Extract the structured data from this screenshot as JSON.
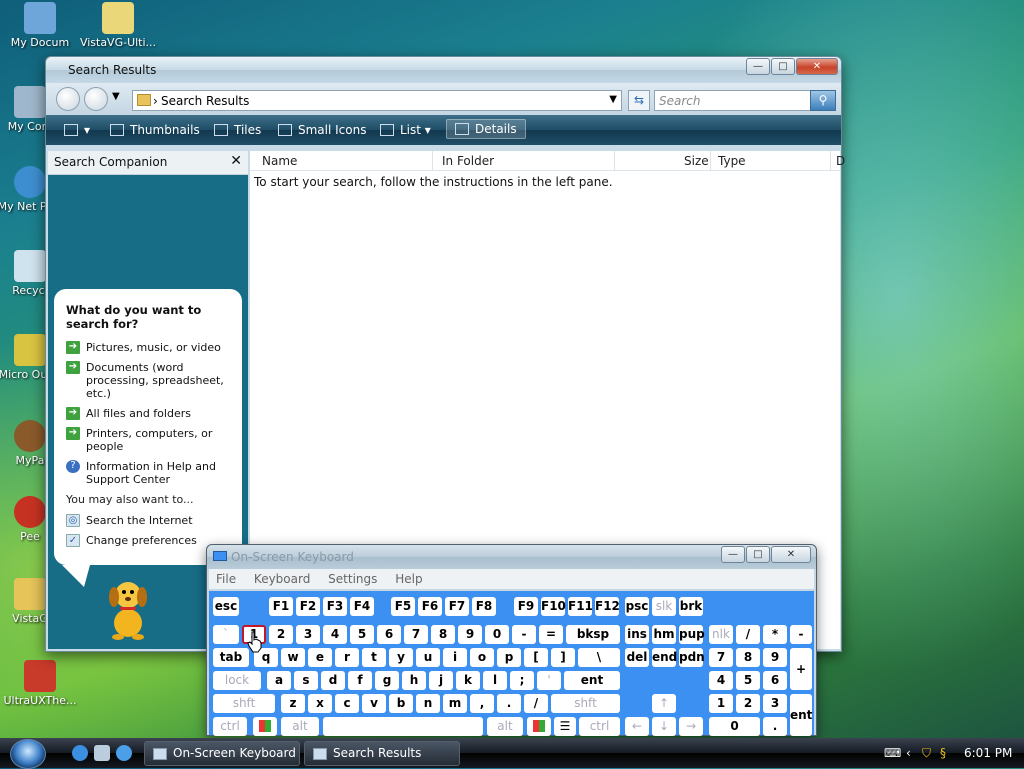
{
  "desktop": {
    "icons": [
      {
        "label": "My Docum"
      },
      {
        "label": "VistaVG-Ulti..."
      },
      {
        "label": "My Com"
      },
      {
        "label": "My Net Plac"
      },
      {
        "label": "Recycl"
      },
      {
        "label": "Micro Outlo"
      },
      {
        "label": "MyPa"
      },
      {
        "label": "Pee"
      },
      {
        "label": "VistaG"
      },
      {
        "label": "UltraUXThe..."
      }
    ]
  },
  "explorer": {
    "title": "Search Results",
    "address": "Search Results",
    "search_placeholder": "Search",
    "toolbar": [
      "Thumbnails",
      "Tiles",
      "Small Icons",
      "List",
      "Details"
    ],
    "companion_title": "Search Companion",
    "question": "What do you want to search for?",
    "options": [
      "Pictures, music, or video",
      "Documents (word processing, spreadsheet, etc.)",
      "All files and folders",
      "Printers, computers, or people",
      "Information in Help and Support Center"
    ],
    "also_label": "You may also want to...",
    "also_options": [
      "Search the Internet",
      "Change preferences"
    ],
    "columns": [
      "Name",
      "In Folder",
      "Size",
      "Type",
      "D"
    ],
    "hint": "To start your search, follow the instructions in the left pane."
  },
  "osk": {
    "title": "On-Screen Keyboard",
    "menu": [
      "File",
      "Keyboard",
      "Settings",
      "Help"
    ],
    "row1": [
      "esc",
      "F1",
      "F2",
      "F3",
      "F4",
      "F5",
      "F6",
      "F7",
      "F8",
      "F9",
      "F10",
      "F11",
      "F12",
      "psc",
      "slk",
      "brk"
    ],
    "row2": [
      "`",
      "1",
      "2",
      "3",
      "4",
      "5",
      "6",
      "7",
      "8",
      "9",
      "0",
      "-",
      "=",
      "bksp",
      "ins",
      "hm",
      "pup",
      "nlk",
      "/",
      "*",
      "-"
    ],
    "row3": [
      "tab",
      "q",
      "w",
      "e",
      "r",
      "t",
      "y",
      "u",
      "i",
      "o",
      "p",
      "[",
      "]",
      "\\",
      "del",
      "end",
      "pdn",
      "7",
      "8",
      "9",
      "+"
    ],
    "row4": [
      "lock",
      "a",
      "s",
      "d",
      "f",
      "g",
      "h",
      "j",
      "k",
      "l",
      ";",
      "'",
      "ent",
      "4",
      "5",
      "6"
    ],
    "row5": [
      "shft",
      "z",
      "x",
      "c",
      "v",
      "b",
      "n",
      "m",
      ",",
      ".",
      "/",
      "shft",
      "↑",
      "1",
      "2",
      "3",
      "ent"
    ],
    "row6": [
      "ctrl",
      "alt",
      "alt",
      "ctrl",
      "←",
      "↓",
      "→",
      "0",
      "."
    ]
  },
  "taskbar": {
    "tasks": [
      "On-Screen Keyboard",
      "Search Results"
    ],
    "clock": "6:01 PM"
  }
}
